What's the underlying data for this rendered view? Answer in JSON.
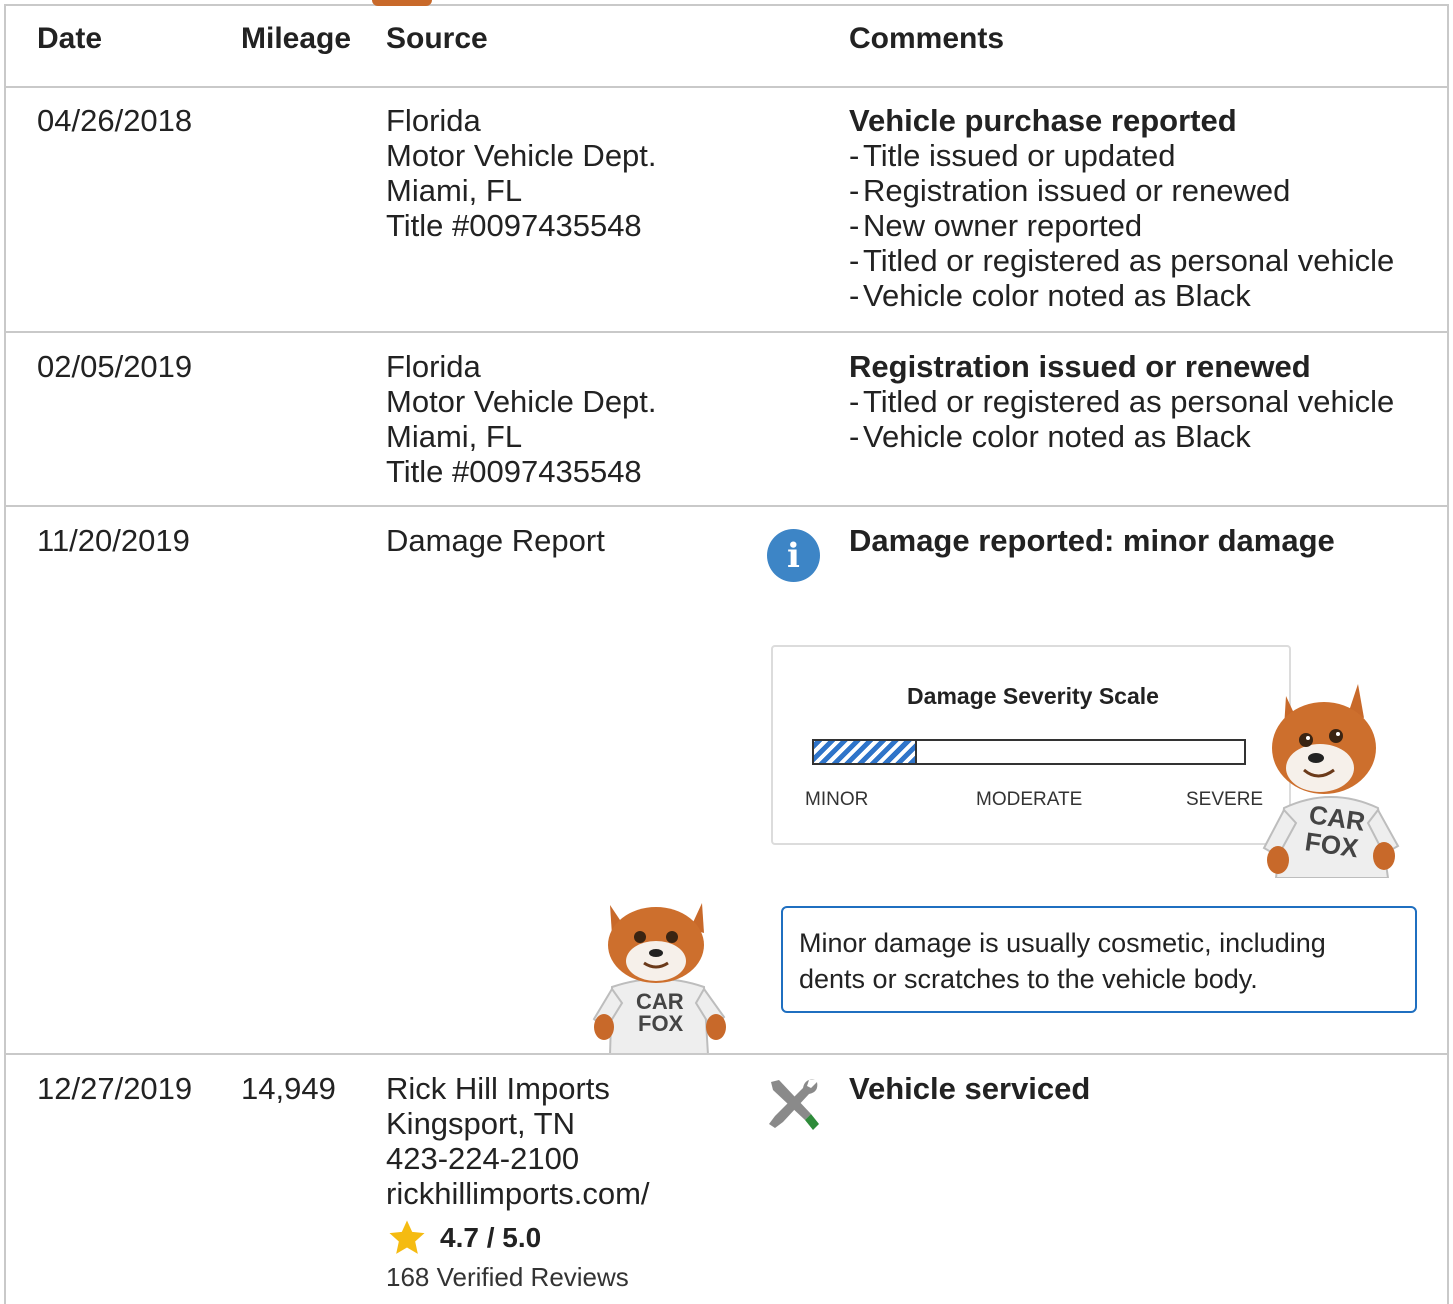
{
  "headers": {
    "date": "Date",
    "mileage": "Mileage",
    "source": "Source",
    "comments": "Comments"
  },
  "records": [
    {
      "date": "04/26/2018",
      "mileage": "",
      "source": [
        "Florida",
        "Motor Vehicle Dept.",
        "Miami, FL",
        "Title #0097435548"
      ],
      "comment_title": "Vehicle purchase reported",
      "comment_items": [
        "Title issued or updated",
        "Registration issued or renewed",
        "New owner reported",
        "Titled or registered as personal vehicle",
        "Vehicle color noted as Black"
      ]
    },
    {
      "date": "02/05/2019",
      "mileage": "",
      "source": [
        "Florida",
        "Motor Vehicle Dept.",
        "Miami, FL",
        "Title #0097435548"
      ],
      "comment_title": "Registration issued or renewed",
      "comment_items": [
        "Titled or registered as personal vehicle",
        "Vehicle color noted as Black"
      ]
    },
    {
      "date": "11/20/2019",
      "mileage": "",
      "source": [
        "Damage Report"
      ],
      "icon": "info-icon",
      "comment_title": "Damage reported: minor damage",
      "severity_scale": {
        "title": "Damage Severity Scale",
        "level": 0.24,
        "labels": [
          "MINOR",
          "MODERATE",
          "SEVERE"
        ]
      },
      "note": "Minor damage is usually cosmetic, including dents or scratches to the vehicle body."
    },
    {
      "date": "12/27/2019",
      "mileage": "14,949",
      "source": [
        "Rick Hill Imports",
        "Kingsport, TN",
        "423-224-2100",
        "rickhillimports.com/"
      ],
      "rating": "4.7 / 5.0",
      "reviews": "168 Verified Reviews",
      "icon": "wrench-screwdriver-icon",
      "comment_title": "Vehicle serviced"
    }
  ],
  "mascot": {
    "shirt_text_line1": "CAR",
    "shirt_text_line2": "FOX"
  },
  "colors": {
    "accent_blue": "#3d85c6",
    "callout_border": "#1f6fc0",
    "star": "#f5bb11"
  }
}
